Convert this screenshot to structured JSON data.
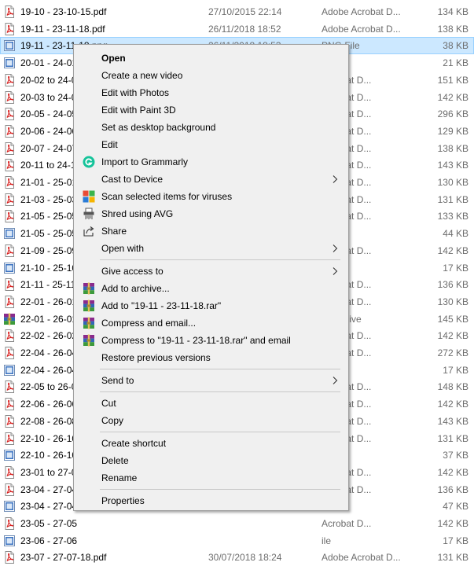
{
  "files": [
    {
      "name": "19-10 - 23-10-15.pdf",
      "date": "27/10/2015 22:14",
      "type": "Adobe Acrobat D...",
      "size": "134 KB",
      "kind": "pdf",
      "selected": false
    },
    {
      "name": "19-11 - 23-11-18.pdf",
      "date": "26/11/2018 18:52",
      "type": "Adobe Acrobat D...",
      "size": "138 KB",
      "kind": "pdf",
      "selected": false
    },
    {
      "name": "19-11 - 23-11-18.png",
      "date": "26/11/2018 18:53",
      "type": "PNG File",
      "size": "38 KB",
      "kind": "png",
      "selected": true
    },
    {
      "name": "20-01 - 24-01",
      "date": "",
      "type": "ile",
      "size": "21 KB",
      "kind": "png",
      "selected": false
    },
    {
      "name": "20-02 to 24-0",
      "date": "",
      "type": "Acrobat D...",
      "size": "151 KB",
      "kind": "pdf",
      "selected": false
    },
    {
      "name": "20-03 to 24-0",
      "date": "",
      "type": "Acrobat D...",
      "size": "142 KB",
      "kind": "pdf",
      "selected": false
    },
    {
      "name": "20-05 - 24-05",
      "date": "",
      "type": "Acrobat D...",
      "size": "296 KB",
      "kind": "pdf",
      "selected": false
    },
    {
      "name": "20-06 - 24-06",
      "date": "",
      "type": "Acrobat D...",
      "size": "129 KB",
      "kind": "pdf",
      "selected": false
    },
    {
      "name": "20-07 - 24-07",
      "date": "",
      "type": "Acrobat D...",
      "size": "138 KB",
      "kind": "pdf",
      "selected": false
    },
    {
      "name": "20-11 to 24-1",
      "date": "",
      "type": "Acrobat D...",
      "size": "143 KB",
      "kind": "pdf",
      "selected": false
    },
    {
      "name": "21-01 - 25-01",
      "date": "",
      "type": "Acrobat D...",
      "size": "130 KB",
      "kind": "pdf",
      "selected": false
    },
    {
      "name": "21-03 - 25-03",
      "date": "",
      "type": "Acrobat D...",
      "size": "131 KB",
      "kind": "pdf",
      "selected": false
    },
    {
      "name": "21-05 - 25-05",
      "date": "",
      "type": "Acrobat D...",
      "size": "133 KB",
      "kind": "pdf",
      "selected": false
    },
    {
      "name": "21-05 - 25-05",
      "date": "",
      "type": "ile",
      "size": "44 KB",
      "kind": "png",
      "selected": false
    },
    {
      "name": "21-09 - 25-09",
      "date": "",
      "type": "Acrobat D...",
      "size": "142 KB",
      "kind": "pdf",
      "selected": false
    },
    {
      "name": "21-10 - 25-10",
      "date": "",
      "type": "ile",
      "size": "17 KB",
      "kind": "png",
      "selected": false
    },
    {
      "name": "21-11 - 25-11",
      "date": "",
      "type": "Acrobat D...",
      "size": "136 KB",
      "kind": "pdf",
      "selected": false
    },
    {
      "name": "22-01 - 26-01",
      "date": "",
      "type": "Acrobat D...",
      "size": "130 KB",
      "kind": "pdf",
      "selected": false
    },
    {
      "name": "22-01 - 26-01",
      "date": "",
      "type": "R archive",
      "size": "145 KB",
      "kind": "rar",
      "selected": false
    },
    {
      "name": "22-02 - 26-02",
      "date": "",
      "type": "Acrobat D...",
      "size": "142 KB",
      "kind": "pdf",
      "selected": false
    },
    {
      "name": "22-04 - 26-04",
      "date": "",
      "type": "Acrobat D...",
      "size": "272 KB",
      "kind": "pdf",
      "selected": false
    },
    {
      "name": "22-04 - 26-04",
      "date": "",
      "type": "ile",
      "size": "17 KB",
      "kind": "png",
      "selected": false
    },
    {
      "name": "22-05 to 26-0",
      "date": "",
      "type": "Acrobat D...",
      "size": "148 KB",
      "kind": "pdf",
      "selected": false
    },
    {
      "name": "22-06 - 26-06",
      "date": "",
      "type": "Acrobat D...",
      "size": "142 KB",
      "kind": "pdf",
      "selected": false
    },
    {
      "name": "22-08 - 26-08",
      "date": "",
      "type": "Acrobat D...",
      "size": "143 KB",
      "kind": "pdf",
      "selected": false
    },
    {
      "name": "22-10 - 26-10",
      "date": "",
      "type": "Acrobat D...",
      "size": "131 KB",
      "kind": "pdf",
      "selected": false
    },
    {
      "name": "22-10 - 26-10",
      "date": "",
      "type": "ile",
      "size": "37 KB",
      "kind": "png",
      "selected": false
    },
    {
      "name": "23-01 to 27-0",
      "date": "",
      "type": "Acrobat D...",
      "size": "142 KB",
      "kind": "pdf",
      "selected": false
    },
    {
      "name": "23-04 - 27-04",
      "date": "",
      "type": "Acrobat D...",
      "size": "136 KB",
      "kind": "pdf",
      "selected": false
    },
    {
      "name": "23-04 - 27-04",
      "date": "",
      "type": "ile",
      "size": "47 KB",
      "kind": "png",
      "selected": false
    },
    {
      "name": "23-05 - 27-05",
      "date": "",
      "type": "Acrobat D...",
      "size": "142 KB",
      "kind": "pdf",
      "selected": false
    },
    {
      "name": "23-06 - 27-06",
      "date": "",
      "type": "ile",
      "size": "17 KB",
      "kind": "png",
      "selected": false
    },
    {
      "name": "23-07 - 27-07-18.pdf",
      "date": "30/07/2018 18:24",
      "type": "Adobe Acrobat D...",
      "size": "131 KB",
      "kind": "pdf",
      "selected": false
    }
  ],
  "menu": {
    "items": [
      {
        "label": "Open",
        "bold": true,
        "icon": "",
        "arrow": false
      },
      {
        "label": "Create a new video",
        "icon": "",
        "arrow": false
      },
      {
        "label": "Edit with Photos",
        "icon": "",
        "arrow": false
      },
      {
        "label": "Edit with Paint 3D",
        "icon": "",
        "arrow": false
      },
      {
        "label": "Set as desktop background",
        "icon": "",
        "arrow": false
      },
      {
        "label": "Edit",
        "icon": "",
        "arrow": false
      },
      {
        "label": "Import to Grammarly",
        "icon": "grammarly-icon",
        "arrow": false
      },
      {
        "label": "Cast to Device",
        "icon": "",
        "arrow": true
      },
      {
        "label": "Scan selected items for viruses",
        "icon": "antivirus-scan-icon",
        "arrow": false
      },
      {
        "label": "Shred using AVG",
        "icon": "shredder-icon",
        "arrow": false
      },
      {
        "label": "Share",
        "icon": "share-icon",
        "arrow": false
      },
      {
        "label": "Open with",
        "icon": "",
        "arrow": true
      },
      {
        "separator": true
      },
      {
        "label": "Give access to",
        "icon": "",
        "arrow": true
      },
      {
        "label": "Add to archive...",
        "icon": "winrar-icon",
        "arrow": false
      },
      {
        "label": "Add to \"19-11 - 23-11-18.rar\"",
        "icon": "winrar-icon",
        "arrow": false
      },
      {
        "label": "Compress and email...",
        "icon": "winrar-icon",
        "arrow": false
      },
      {
        "label": "Compress to \"19-11 - 23-11-18.rar\" and email",
        "icon": "winrar-icon",
        "arrow": false
      },
      {
        "label": "Restore previous versions",
        "icon": "",
        "arrow": false
      },
      {
        "separator": true
      },
      {
        "label": "Send to",
        "icon": "",
        "arrow": true
      },
      {
        "separator": true
      },
      {
        "label": "Cut",
        "icon": "",
        "arrow": false
      },
      {
        "label": "Copy",
        "icon": "",
        "arrow": false
      },
      {
        "separator": true
      },
      {
        "label": "Create shortcut",
        "icon": "",
        "arrow": false
      },
      {
        "label": "Delete",
        "icon": "",
        "arrow": false
      },
      {
        "label": "Rename",
        "icon": "",
        "arrow": false
      },
      {
        "separator": true
      },
      {
        "label": "Properties",
        "icon": "",
        "arrow": false
      }
    ]
  },
  "colors": {
    "selection": "#cce8ff",
    "selection_border": "#99d1ff",
    "menu_bg": "#f0f0f0",
    "pdf_red": "#d7201f",
    "grammarly_green": "#15c39a"
  }
}
